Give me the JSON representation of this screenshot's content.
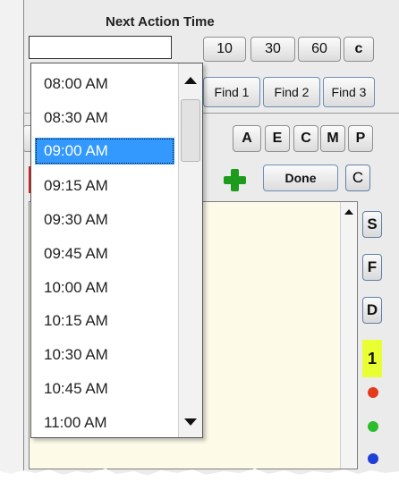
{
  "panel": {
    "title": "Next Action Time",
    "time_input": {
      "value": ""
    },
    "quick_buttons": [
      "10",
      "30",
      "60",
      "c"
    ],
    "find_buttons": [
      "Find 1",
      "Find 2",
      "Find 3"
    ],
    "filter_buttons": [
      "A",
      "E",
      "C",
      "M",
      "P"
    ],
    "done_label": "Done",
    "c_label": "C",
    "side_buttons": [
      "S",
      "F",
      "D"
    ],
    "badge": "1",
    "dot_colors": [
      "#e53b1c",
      "#2bbd2b",
      "#1f3fd6"
    ]
  },
  "dropdown": {
    "options": [
      "08:00 AM",
      "08:30 AM",
      "09:00 AM",
      "09:15 AM",
      "09:30 AM",
      "09:45 AM",
      "10:00 AM",
      "10:15 AM",
      "10:30 AM",
      "10:45 AM",
      "11:00 AM"
    ],
    "selected": "09:00 AM"
  },
  "icons": {
    "scroll_up": "triangle-up-icon",
    "scroll_down": "triangle-down-icon",
    "add": "green-plus-icon"
  }
}
